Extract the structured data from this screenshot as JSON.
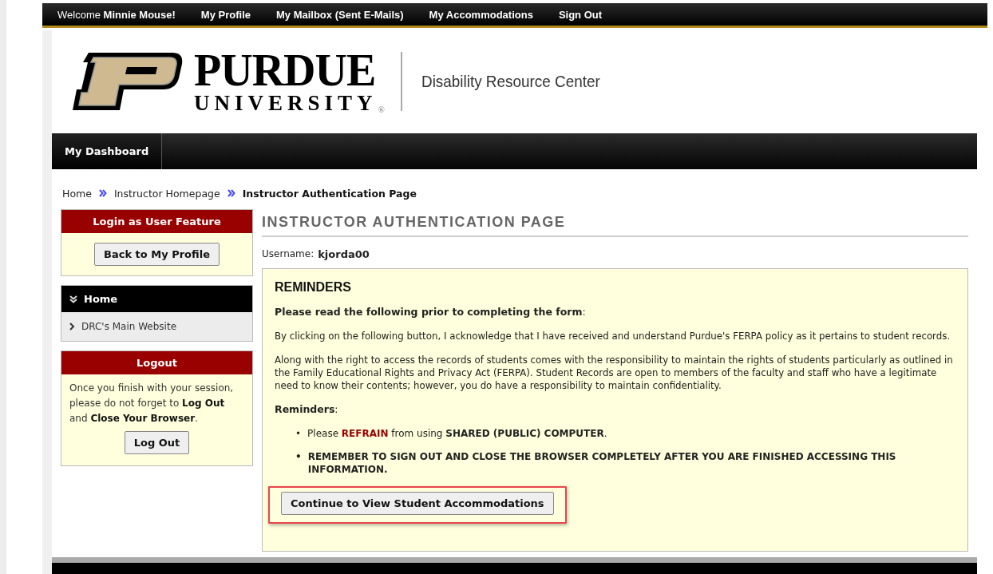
{
  "top_bar": {
    "welcome": "Welcome **Minnie Mouse!**",
    "links": [
      {
        "label": "My Profile"
      },
      {
        "label": "My Mailbox (Sent E-Mails)"
      },
      {
        "label": "My Accommodations"
      },
      {
        "label": "Sign Out"
      }
    ]
  },
  "header": {
    "logo_name": "PURDUE",
    "logo_sub": "UNIVERSITY",
    "logo_mark": "®",
    "site_title": "Disability Resource Center"
  },
  "nav": {
    "tabs": [
      {
        "label": "My Dashboard",
        "selected": true
      }
    ]
  },
  "breadcrumb": [
    {
      "label": "Home",
      "current": false
    },
    {
      "label": "Instructor Homepage",
      "current": false
    },
    {
      "label": "Instructor Authentication Page",
      "current": true
    }
  ],
  "sidebar": {
    "login_box": {
      "title": "Login as User Feature",
      "button": "Back to My Profile"
    },
    "menu": {
      "title": "Home",
      "expanded": true,
      "items": [
        {
          "label": "DRC's Main Website"
        }
      ]
    },
    "logout_box": {
      "title": "Logout",
      "text": "Once you finish with your session, please do not forget to **Log Out** and **Close Your Browser**.",
      "button": "Log Out"
    }
  },
  "main": {
    "title": "INSTRUCTOR AUTHENTICATION PAGE",
    "username_label": "Username:",
    "username": "kjorda00",
    "reminders": {
      "heading": "REMINDERS",
      "intro": "**Please read the following prior to completing the form**:",
      "paragraphs": [
        "By clicking on the following button, I acknowledge that I have received and understand Purdue's FERPA policy as it pertains to student records.",
        "Along with the right to access the records of students comes with the responsibility to maintain the rights of students particularly as outlined in the Family Educational Rights and Privacy Act (FERPA). Student Records are open to members of the faculty and staff who have a legitimate need to know their contents; however, you do have a responsibility to maintain confidentiality."
      ],
      "list_heading": "**Reminders**:",
      "bullets": [
        {
          "kind": "plain",
          "marker": "•",
          "text": "Please **REFRAIN** from using **SHARED (PUBLIC) COMPUTER**."
        },
        {
          "kind": "strong",
          "marker": "•",
          "text": "REMEMBER TO SIGN OUT AND CLOSE THE BROWSER COMPLETELY AFTER YOU ARE FINISHED ACCESSING THIS INFORMATION."
        }
      ],
      "button": {
        "label": "Continue to View Student Accommodations",
        "highlighted": true
      }
    }
  }
}
